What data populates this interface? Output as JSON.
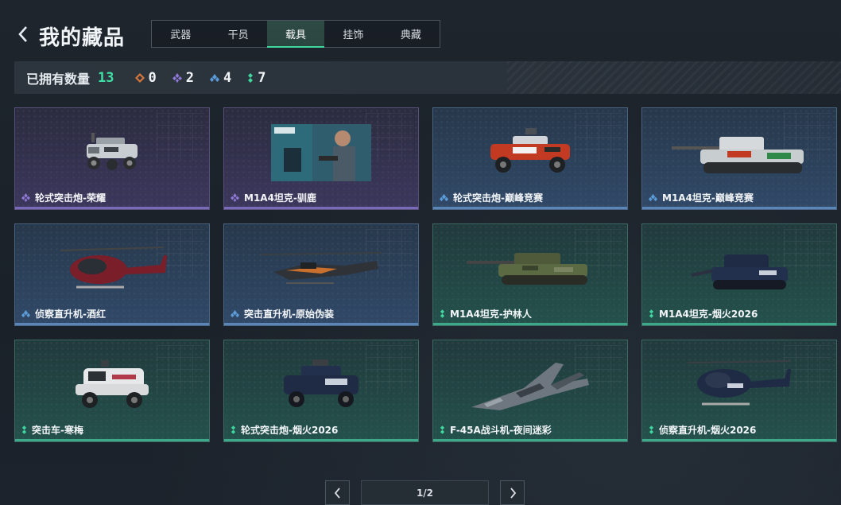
{
  "header": {
    "title": "我的藏品",
    "tabs": [
      {
        "label": "武器",
        "active": false
      },
      {
        "label": "干员",
        "active": false
      },
      {
        "label": "载具",
        "active": true
      },
      {
        "label": "挂饰",
        "active": false
      },
      {
        "label": "典藏",
        "active": false
      }
    ]
  },
  "stats": {
    "label": "已拥有数量",
    "total": "13",
    "counts": [
      {
        "icon": "orange-rarity-icon",
        "color": "#d9763a",
        "value": "0"
      },
      {
        "icon": "purple-rarity-icon",
        "color": "#8f7ad6",
        "value": "2"
      },
      {
        "icon": "blue-rarity-icon",
        "color": "#5b9bd8",
        "value": "4"
      },
      {
        "icon": "green-rarity-icon",
        "color": "#3fd6a0",
        "value": "7"
      }
    ]
  },
  "items": [
    {
      "name": "轮式突击炮-荣耀",
      "rarity": "purple",
      "art": "armored-car"
    },
    {
      "name": "M1A4坦克-驯鹿",
      "rarity": "purple",
      "art": "poster"
    },
    {
      "name": "轮式突击炮-巅峰竞赛",
      "rarity": "blue",
      "art": "armored-car-red"
    },
    {
      "name": "M1A4坦克-巅峰竞赛",
      "rarity": "blue",
      "art": "tank-red"
    },
    {
      "name": "侦察直升机-酒红",
      "rarity": "blue",
      "art": "heli-red"
    },
    {
      "name": "突击直升机-原始伪装",
      "rarity": "blue",
      "art": "heli-attack"
    },
    {
      "name": "M1A4坦克-护林人",
      "rarity": "green",
      "art": "tank-camo"
    },
    {
      "name": "M1A4坦克-烟火2026",
      "rarity": "green",
      "art": "tank-navy"
    },
    {
      "name": "突击车-寒梅",
      "rarity": "green",
      "art": "truck-white"
    },
    {
      "name": "轮式突击炮-烟火2026",
      "rarity": "green",
      "art": "armored-car-navy"
    },
    {
      "name": "F-45A战斗机-夜间迷彩",
      "rarity": "green",
      "art": "jet"
    },
    {
      "name": "侦察直升机-烟火2026",
      "rarity": "green",
      "art": "heli-navy"
    }
  ],
  "pager": {
    "page": "1/2"
  },
  "colors": {
    "accent_green": "#3fe0a4",
    "purple": "#8f7ad6",
    "blue": "#5b9bd8",
    "green": "#3fd6a0"
  }
}
